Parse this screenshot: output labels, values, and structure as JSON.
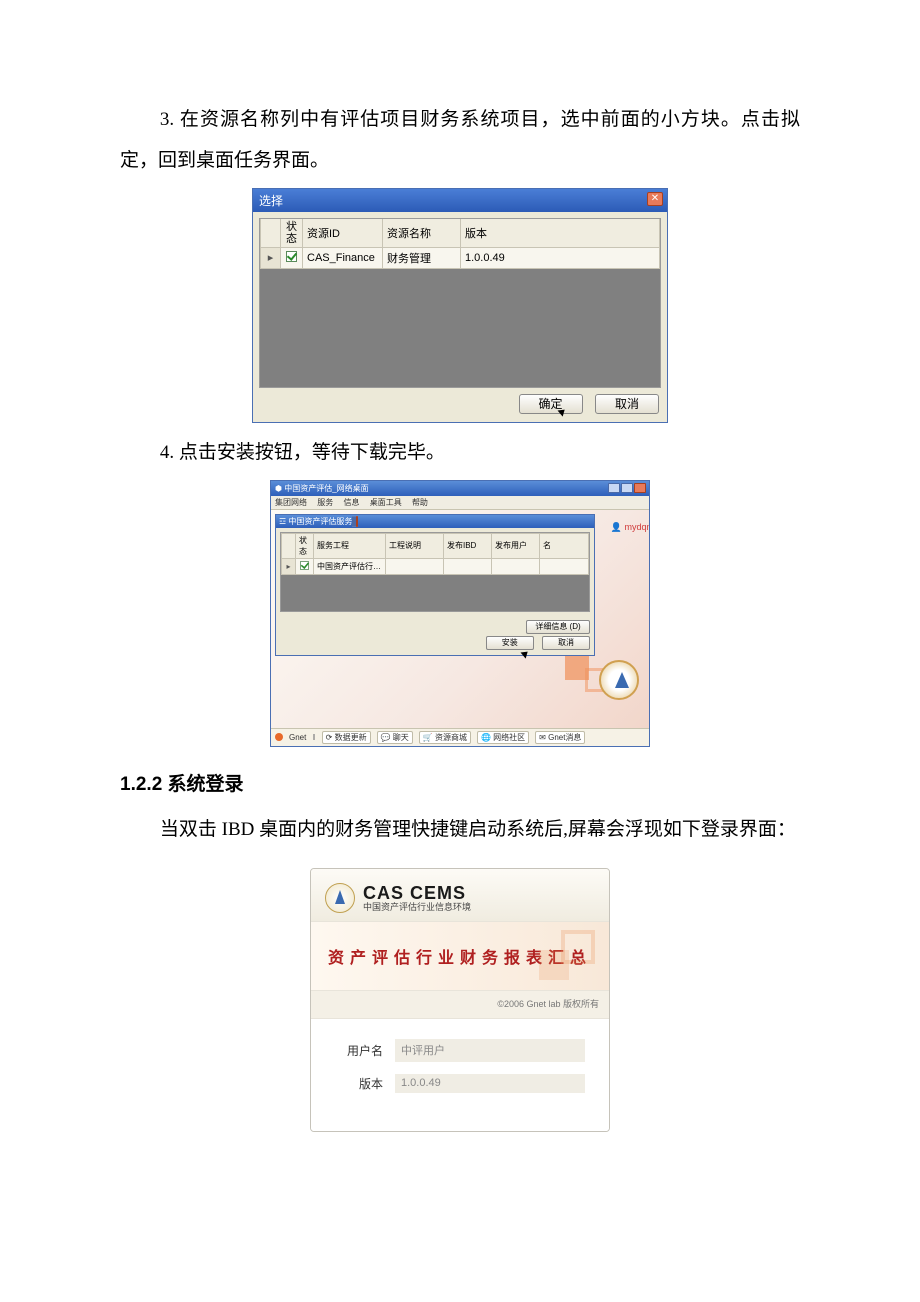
{
  "text": {
    "p1": "3. 在资源名称列中有评估项目财务系统项目，选中前面的小方块。点击拟定，回到桌面任务界面。",
    "p2": "4. 点击安装按钮，等待下载完毕。",
    "h122": "1.2.2 系统登录",
    "p3": "当双击 IBD 桌面内的财务管理快捷键启动系统后,屏幕会浮现如下登录界面："
  },
  "dialog1": {
    "title": "选择",
    "headers": {
      "state": "状态",
      "id": "资源ID",
      "name": "资源名称",
      "ver": "版本"
    },
    "row": {
      "id": "CAS_Finance",
      "name": "财务管理",
      "ver": "1.0.0.49"
    },
    "ok": "确定",
    "cancel": "取消"
  },
  "app2": {
    "title": "中国资产评估_网络桌面",
    "menu": [
      "集团网络",
      "服务",
      "信息",
      "桌面工具",
      "帮助"
    ],
    "subtitle": "中国资产评估服务",
    "user_prefix": "mydqnye",
    "cols": [
      "状态",
      "服务工程",
      "工程说明",
      "发布IBD",
      "发布用户",
      "名"
    ],
    "row_name": "中国资产评估行…",
    "detail_btn": "详细信息 (D)",
    "install_btn": "安装",
    "cancel_btn": "取消",
    "status_brand": "Gnet",
    "status_items": [
      "数据更新",
      "聊天",
      "资源商城",
      "网络社区",
      "Gnet消息"
    ]
  },
  "login": {
    "brand": "CAS CEMS",
    "brand_sub": "中国资产评估行业信息环境",
    "banner": "资产评估行业财务报表汇总",
    "copyright": "©2006 Gnet lab  版权所有",
    "user_label": "用户名",
    "user_value": "中评用户",
    "ver_label": "版本",
    "ver_value": "1.0.0.49"
  }
}
